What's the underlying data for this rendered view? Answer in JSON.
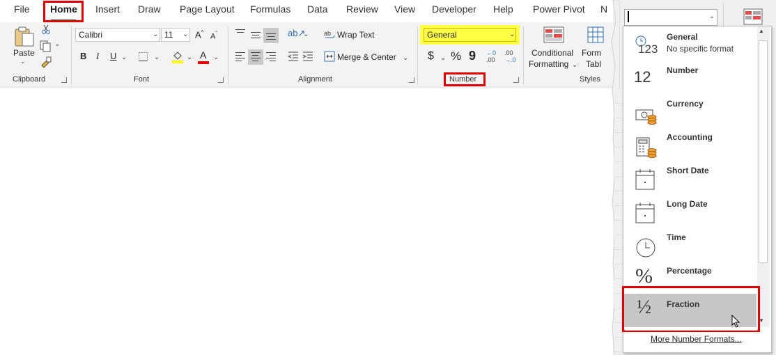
{
  "tabs": [
    "File",
    "Home",
    "Insert",
    "Draw",
    "Page Layout",
    "Formulas",
    "Data",
    "Review",
    "View",
    "Developer",
    "Help",
    "Power Pivot",
    "N"
  ],
  "clipboard": {
    "paste_label": "Paste",
    "group_label": "Clipboard"
  },
  "font": {
    "name": "Calibri",
    "size": "11",
    "bold": "B",
    "italic": "I",
    "underline": "U",
    "grow": "A",
    "shrink": "A",
    "fill_letter": "A",
    "group_label": "Font"
  },
  "alignment": {
    "wrap_text": "Wrap Text",
    "merge_center": "Merge & Center",
    "group_label": "Alignment"
  },
  "number": {
    "format": "General",
    "currency": "$",
    "percent": "%",
    "comma": "9",
    "inc_decimal_top": "←0",
    "inc_decimal_bottom": ".00",
    "dec_decimal_top": ".00",
    "dec_decimal_bottom": "→.0",
    "group_label": "Number"
  },
  "styles": {
    "conditional_1": "Conditional",
    "conditional_2": "Formatting",
    "format_table_1": "Form",
    "format_table_2": "Tabl",
    "group_label": "Styles"
  },
  "format_box": {
    "value": ""
  },
  "format_menu": {
    "items": [
      {
        "label": "General",
        "sub": "No specific format",
        "icon": "123"
      },
      {
        "label": "Number",
        "sub": "",
        "icon": "12"
      },
      {
        "label": "Currency",
        "sub": "",
        "icon": ""
      },
      {
        "label": "Accounting",
        "sub": "",
        "icon": ""
      },
      {
        "label": "Short Date",
        "sub": "",
        "icon": ""
      },
      {
        "label": "Long Date",
        "sub": "",
        "icon": ""
      },
      {
        "label": "Time",
        "sub": "",
        "icon": ""
      },
      {
        "label": "Percentage",
        "sub": "",
        "icon": "%"
      },
      {
        "label": "Fraction",
        "sub": "",
        "icon": "½"
      }
    ],
    "more": "More Number Formats..."
  },
  "colors": {
    "accent_green": "#217346",
    "highlight_red": "#e00000",
    "general_highlight": "#ffff44",
    "selected_item": "#c6c6c6"
  }
}
